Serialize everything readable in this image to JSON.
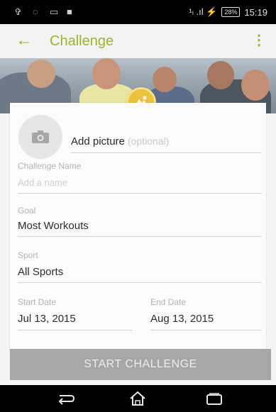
{
  "status_bar": {
    "time": "15:19",
    "battery": "28%",
    "signal": "¹ₗ .ıl ⚡"
  },
  "toolbar": {
    "title": "Challenge"
  },
  "form": {
    "add_picture_label": "Add picture",
    "add_picture_optional": "(optional)",
    "challenge_name_label": "Challenge Name",
    "challenge_name_placeholder": "Add a name",
    "goal_label": "Goal",
    "goal_value": "Most Workouts",
    "sport_label": "Sport",
    "sport_value": "All Sports",
    "start_date_label": "Start Date",
    "start_date_value": "Jul 13, 2015",
    "end_date_label": "End Date",
    "end_date_value": "Aug 13, 2015"
  },
  "actions": {
    "start_label": "START CHALLENGE"
  },
  "colors": {
    "accent": "#9cb625",
    "badge": "#ecc23a",
    "button": "#a7a7a7"
  }
}
